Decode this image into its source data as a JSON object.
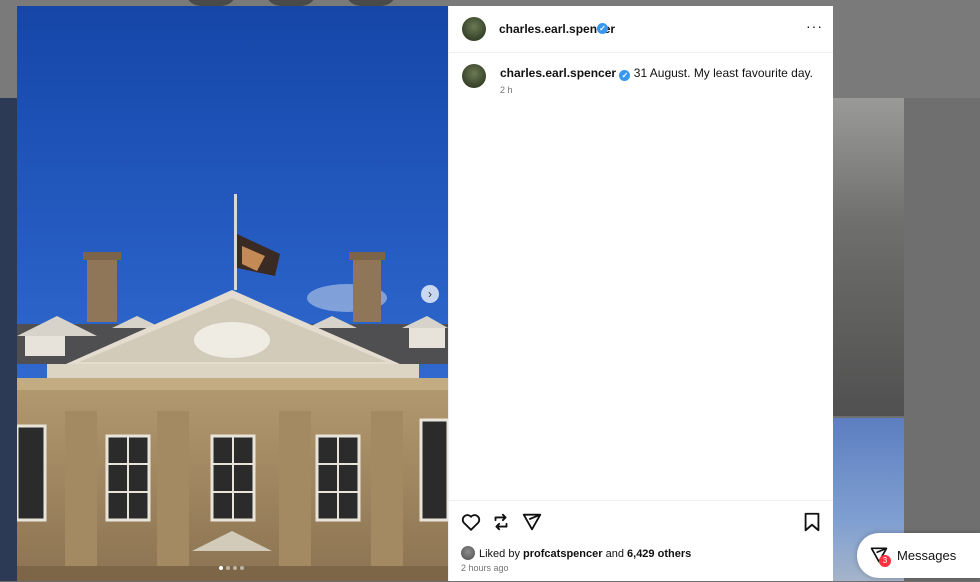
{
  "post": {
    "author": "charles.earl.spencer",
    "verified_glyph": "✓",
    "more_glyph": "···",
    "caption_author": "charles.earl.spencer",
    "caption": "31 August. My least favourite day.",
    "caption_time": "2 h",
    "liked_by_prefix": "Liked by",
    "liked_by_user": "profcatspencer",
    "liked_by_and": "and",
    "liked_by_others": "6,429 others",
    "posted_ago": "2 hours ago",
    "carousel_next_glyph": "›",
    "carousel_dots": 4,
    "carousel_active_index": 0
  },
  "actions": {
    "like_icon": "heart-icon",
    "repost_icon": "repost-icon",
    "share_icon": "send-icon",
    "save_icon": "bookmark-icon"
  },
  "messages": {
    "label": "Messages",
    "badge": "3",
    "icon": "messages-icon"
  },
  "colors": {
    "verified": "#3897f0",
    "badge": "#ff3040",
    "sky": "#1f52b8"
  }
}
